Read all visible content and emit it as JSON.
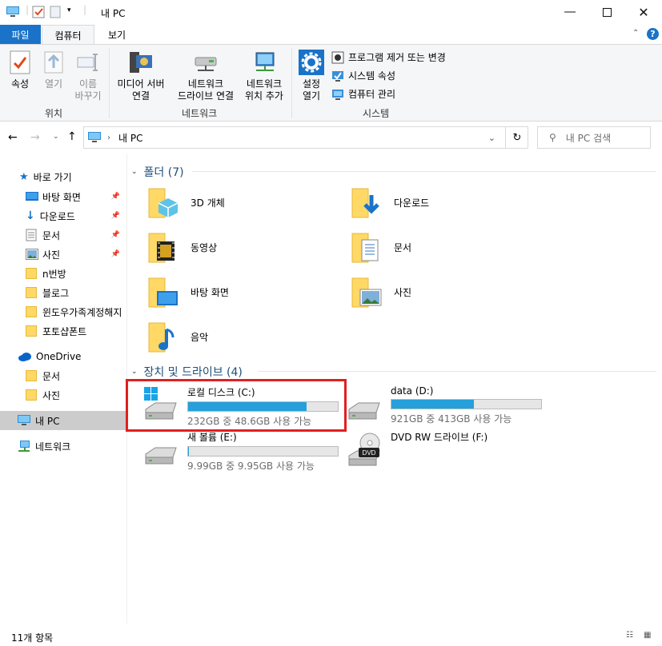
{
  "title": "내 PC",
  "ribbon_tabs": {
    "file": "파일",
    "computer": "컴퓨터",
    "view": "보기"
  },
  "ribbon": {
    "location": {
      "properties": "속성",
      "open": "열기",
      "rename1": "이름",
      "rename2": "바꾸기",
      "group": "위치"
    },
    "network": {
      "media1": "미디어 서버",
      "media2": "연결",
      "map1": "네트워크",
      "map2": "드라이브 연결",
      "add1": "네트워크",
      "add2": "위치 추가",
      "group": "네트워크"
    },
    "system": {
      "settings1": "설정",
      "settings2": "열기",
      "uninstall": "프로그램 제거 또는 변경",
      "sysprops": "시스템 속성",
      "manage": "컴퓨터 관리",
      "group": "시스템"
    }
  },
  "address": {
    "path": "내 PC",
    "search_placeholder": "내 PC 검색"
  },
  "nav": {
    "quick_access": "바로 가기",
    "quick_items": [
      "바탕 화면",
      "다운로드",
      "문서",
      "사진",
      "n번방",
      "블로그",
      "윈도우가족계정해지",
      "포토샵폰트"
    ],
    "onedrive": "OneDrive",
    "onedrive_items": [
      "문서",
      "사진"
    ],
    "this_pc": "내 PC",
    "network": "네트워크"
  },
  "folders": {
    "header": "폴더 (7)",
    "items": [
      "3D 개체",
      "다운로드",
      "동영상",
      "문서",
      "바탕 화면",
      "사진",
      "음악"
    ]
  },
  "drives": {
    "header": "장치 및 드라이브 (4)",
    "items": [
      {
        "name": "로컬 디스크 (C:)",
        "info": "232GB 중 48.6GB 사용 가능",
        "used_fraction": 0.79
      },
      {
        "name": "data (D:)",
        "info": "921GB 중 413GB 사용 가능",
        "used_fraction": 0.55
      },
      {
        "name": "새 볼륨 (E:)",
        "info": "9.99GB 중 9.95GB 사용 가능",
        "used_fraction": 0.004
      },
      {
        "name": "DVD RW 드라이브 (F:)",
        "info": "",
        "used_fraction": null
      }
    ]
  },
  "status": {
    "count": "11개 항목"
  },
  "colors": {
    "accent": "#1a73c9",
    "bar": "#26a0da",
    "highlight": "#e02020"
  }
}
